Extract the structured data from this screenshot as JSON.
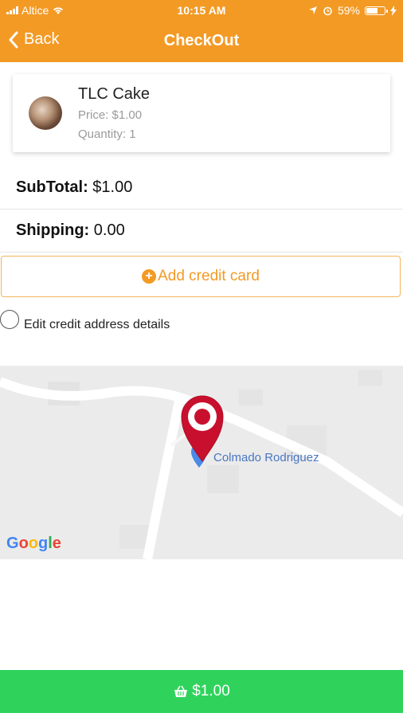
{
  "status_bar": {
    "carrier": "Altice",
    "time": "10:15 AM",
    "battery": "59%"
  },
  "nav": {
    "back_label": "Back",
    "title": "CheckOut"
  },
  "product": {
    "name": "TLC Cake",
    "price": "Price: $1.00",
    "quantity": "Quantity: 1"
  },
  "summary": {
    "subtotal_label": "SubTotal:",
    "subtotal_value": " $1.00",
    "shipping_label": "Shipping:",
    "shipping_value": " 0.00"
  },
  "actions": {
    "add_card_label": "Add credit card",
    "edit_address_label": "Edit credit address details",
    "pay_label": "$1.00"
  },
  "map": {
    "place_name": "Colmado Rodriguez",
    "attribution": "Google"
  },
  "colors": {
    "accent": "#f39a24",
    "pay": "#2fd35c",
    "marker": "#c8102e"
  }
}
